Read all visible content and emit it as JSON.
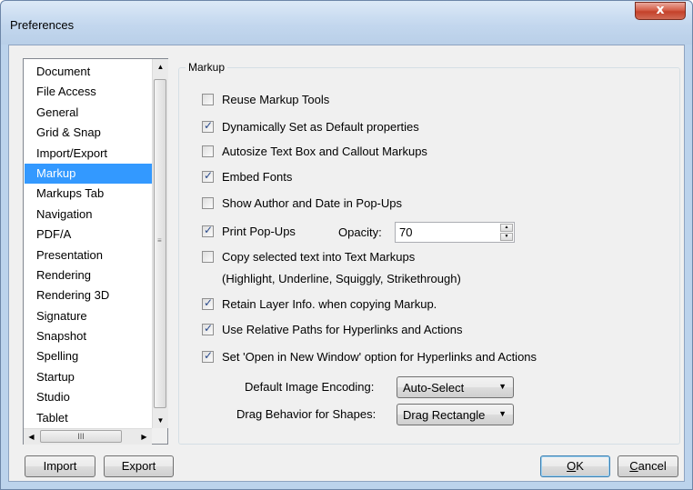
{
  "window": {
    "title": "Preferences",
    "close_glyph": "x"
  },
  "sidebar": {
    "items": [
      {
        "label": "Document"
      },
      {
        "label": "File Access"
      },
      {
        "label": "General"
      },
      {
        "label": "Grid & Snap"
      },
      {
        "label": "Import/Export"
      },
      {
        "label": "Markup",
        "selected": true
      },
      {
        "label": "Markups Tab"
      },
      {
        "label": "Navigation"
      },
      {
        "label": "PDF/A"
      },
      {
        "label": "Presentation"
      },
      {
        "label": "Rendering"
      },
      {
        "label": "Rendering 3D"
      },
      {
        "label": "Signature"
      },
      {
        "label": "Snapshot"
      },
      {
        "label": "Spelling"
      },
      {
        "label": "Startup"
      },
      {
        "label": "Studio"
      },
      {
        "label": "Tablet"
      }
    ],
    "hscroll_grip": "III"
  },
  "markup": {
    "group_title": "Markup",
    "options": [
      {
        "label": "Reuse Markup Tools",
        "checked": false
      },
      {
        "label": "Dynamically Set as Default properties",
        "checked": true
      },
      {
        "label": "Autosize Text Box and Callout Markups",
        "checked": false
      },
      {
        "label": "Embed Fonts",
        "checked": true
      },
      {
        "label": "Show Author and Date in Pop-Ups",
        "checked": false
      },
      {
        "label": "Print Pop-Ups",
        "checked": true
      },
      {
        "label": "Copy selected text into Text Markups",
        "checked": false
      },
      {
        "label": "Retain Layer Info. when copying Markup.",
        "checked": true
      },
      {
        "label": "Use Relative Paths for Hyperlinks and Actions",
        "checked": true
      },
      {
        "label": "Set 'Open in New Window' option for Hyperlinks and Actions",
        "checked": true
      }
    ],
    "copy_sub_note": "(Highlight, Underline, Squiggly, Strikethrough)",
    "opacity_label": "Opacity:",
    "opacity_value": "70",
    "image_encoding_label": "Default Image Encoding:",
    "image_encoding_value": "Auto-Select",
    "drag_behavior_label": "Drag Behavior for Shapes:",
    "drag_behavior_value": "Drag Rectangle"
  },
  "footer": {
    "import_label": "Import",
    "export_label": "Export",
    "ok_mnemonic": "O",
    "ok_rest": "K",
    "cancel_mnemonic": "C",
    "cancel_rest": "ancel"
  },
  "colors": {
    "selection": "#3399ff",
    "title_bg": "#c3d7ee",
    "close_red": "#c4412a"
  }
}
